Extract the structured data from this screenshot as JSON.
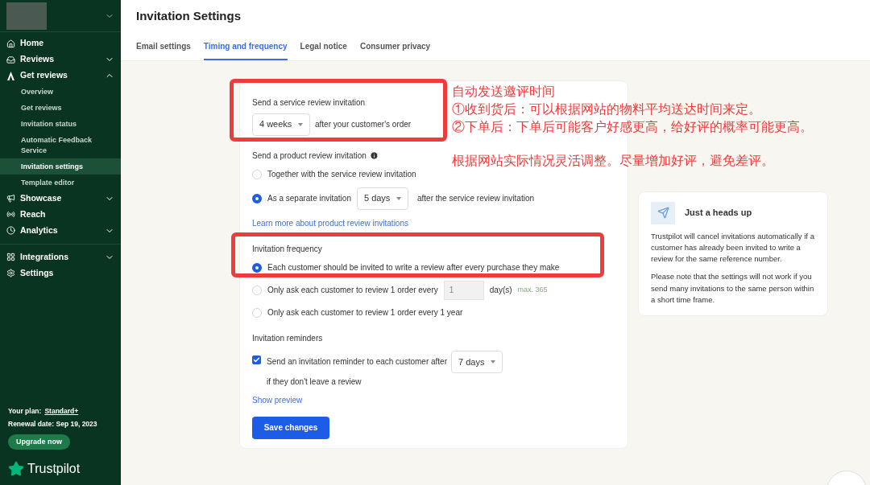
{
  "sidebar": {
    "nav": [
      {
        "label": "Home"
      },
      {
        "label": "Reviews",
        "expanded": false
      },
      {
        "label": "Get reviews",
        "expanded": true,
        "children": [
          {
            "label": "Overview",
            "selected": false
          },
          {
            "label": "Get reviews",
            "selected": false
          },
          {
            "label": "Invitation status",
            "selected": false
          },
          {
            "label": "Automatic Feedback Service",
            "selected": false
          },
          {
            "label": "Invitation settings",
            "selected": true
          },
          {
            "label": "Template editor",
            "selected": false
          }
        ]
      },
      {
        "label": "Showcase",
        "expanded": false
      },
      {
        "label": "Reach"
      },
      {
        "label": "Analytics",
        "expanded": false
      },
      {
        "label": "Integrations",
        "expanded": false,
        "divider": true
      },
      {
        "label": "Settings"
      }
    ],
    "plan_label": "Your plan:",
    "plan": "Standard+",
    "renewal": "Renewal date: Sep 19, 2023",
    "upgrade": "Upgrade now",
    "logo": "Trustpilot"
  },
  "page": {
    "title": "Invitation Settings",
    "tabs": [
      {
        "label": "Email settings",
        "selected": false
      },
      {
        "label": "Timing and frequency",
        "selected": true
      },
      {
        "label": "Legal notice",
        "selected": false
      },
      {
        "label": "Consumer privacy",
        "selected": false
      }
    ]
  },
  "service": {
    "label": "Send a service review invitation",
    "select": "4 weeks",
    "suffix": "after your customer's order",
    "highlighted": true
  },
  "product": {
    "label": "Send a product review invitation",
    "options": [
      {
        "label": "Together with the service review invitation",
        "selected": false
      },
      {
        "label": "As a separate invitation",
        "selected": true,
        "select": "5 days",
        "suffix": "after the service review invitation"
      }
    ],
    "link": "Learn more about product review invitations"
  },
  "frequency": {
    "label": "Invitation frequency",
    "highlighted": true,
    "options": [
      {
        "label": "Each customer should be invited to write a review after every purchase they make",
        "selected": true
      },
      {
        "label": "Only ask each customer to review 1 order every",
        "selected": false,
        "input": "1",
        "input_disabled": true,
        "suffix": "day(s)",
        "hint": "max. 365"
      },
      {
        "label": "Only ask each customer to review 1 order every 1 year",
        "selected": false
      }
    ]
  },
  "reminders": {
    "label": "Invitation reminders",
    "checked": true,
    "text": "Send an invitation reminder to each customer after",
    "select": "7 days",
    "suffix": "if they don't leave a review",
    "link": "Show preview"
  },
  "save": "Save changes",
  "heads_up": {
    "title": "Just a heads up",
    "paragraphs": [
      "Trustpilot will cancel invitations automatically if a customer has already been invited to write a review for the same reference number.",
      "Please note that the settings will not work if you send many invitations to the same person within a short time frame."
    ]
  },
  "annotation": {
    "lines": [
      "自动发送邀评时间",
      "①收到货后：可以根据网站的物料平均送达时间来定。",
      "②下单后：下单后可能客户好感更高，给好评的概率可能更高。"
    ],
    "tip": "根据网站实际情况灵活调整。尽量增加好评，避免差评。"
  }
}
